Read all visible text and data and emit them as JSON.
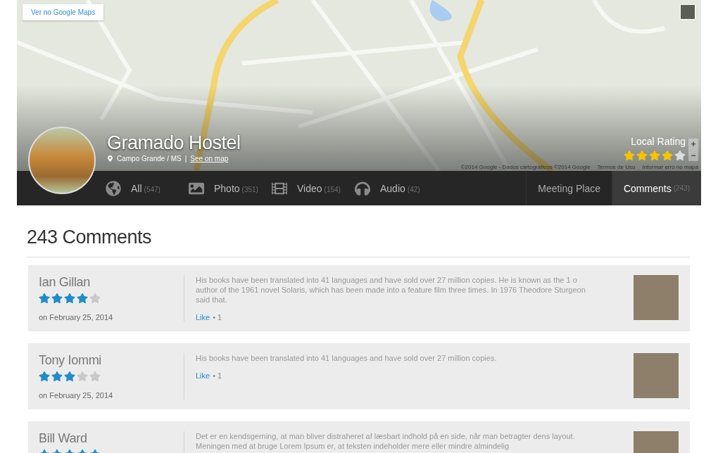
{
  "map": {
    "link": "Ver no Google Maps",
    "attribution": "©2014 Google - Dados cartográficos ©2014 Google",
    "terms": "Termos de Uso",
    "report": "Informar erro no mapa",
    "zoom_in": "+",
    "zoom_out": "−"
  },
  "place": {
    "name": "Gramado Hostel",
    "location": "Campo Grande / MS",
    "separator": "|",
    "map_link": "See on map",
    "rating_label": "Local Rating",
    "stars": 4
  },
  "media_tabs": [
    {
      "kind": "globe",
      "label": "All",
      "count": "(547)"
    },
    {
      "kind": "image",
      "label": "Photo",
      "count": "(351)"
    },
    {
      "kind": "film",
      "label": "Video",
      "count": "(154)"
    },
    {
      "kind": "headphones",
      "label": "Audio",
      "count": "(42)"
    }
  ],
  "section_tabs": [
    {
      "label": "Meeting Place",
      "selected": false
    },
    {
      "label": "Comments",
      "count": "(243)",
      "selected": true
    }
  ],
  "comments_title": "243 Comments",
  "comments": [
    {
      "author": "Ian Gillan",
      "stars": 4,
      "date": "on February 25, 2014",
      "text": "His books have been translated into 41 languages and have sold over 27 million copies. He is known as the 1 o author of the 1961 novel Solaris, which has been made into a feature film three times. In 1976 Theodore Sturgeon said that.",
      "like": "Like",
      "likes": "• 1"
    },
    {
      "author": "Tony Iommi",
      "stars": 3,
      "date": "on February 25, 2014",
      "text": "His books have been translated into 41 languages and have sold over 27 million copies.",
      "like": "Like",
      "likes": "• 1"
    },
    {
      "author": "Bill Ward",
      "stars": 5,
      "text": "Det er en kendsgerning, at man bliver distraheret af læsbart indhold på en side, når man betragter dens layout. Meningen med at bruge Lorem Ipsum er, at teksten indeholder mere eller mindre almindelig"
    }
  ]
}
